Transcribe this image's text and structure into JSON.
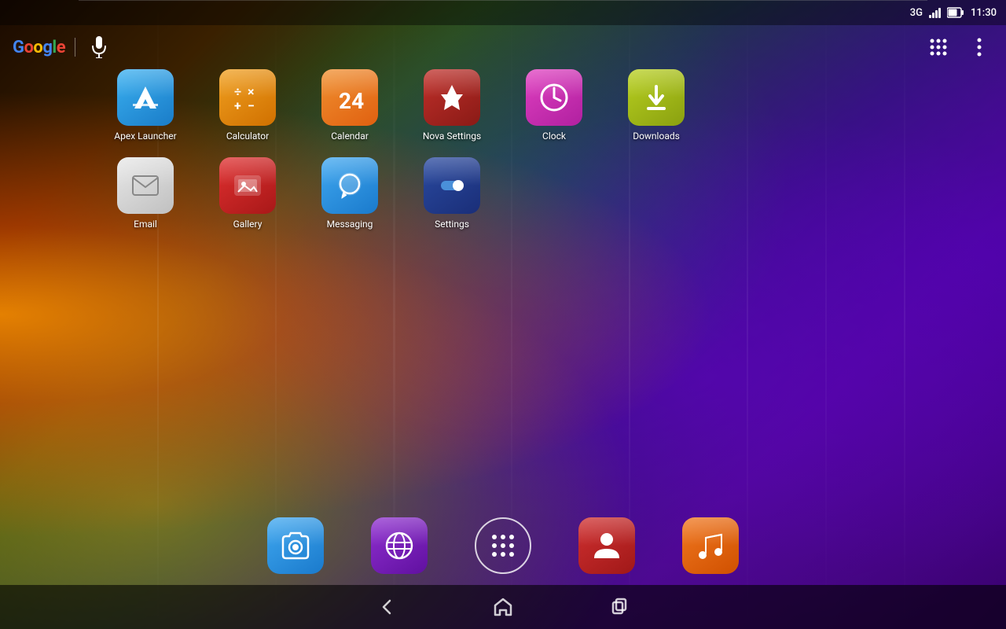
{
  "status_bar": {
    "network": "3G",
    "time": "11:30",
    "battery_level": 70
  },
  "top_bar": {
    "google_label": "Google",
    "mic_label": "Voice Search"
  },
  "apps_row1": [
    {
      "id": "apex-launcher",
      "label": "Apex Launcher",
      "icon_type": "apex"
    },
    {
      "id": "calculator",
      "label": "Calculator",
      "icon_type": "calculator"
    },
    {
      "id": "calendar",
      "label": "Calendar",
      "icon_type": "calendar"
    },
    {
      "id": "nova-settings",
      "label": "Nova Settings",
      "icon_type": "nova"
    },
    {
      "id": "clock",
      "label": "Clock",
      "icon_type": "clock"
    },
    {
      "id": "downloads",
      "label": "Downloads",
      "icon_type": "downloads"
    }
  ],
  "apps_row2": [
    {
      "id": "email",
      "label": "Email",
      "icon_type": "email"
    },
    {
      "id": "gallery",
      "label": "Gallery",
      "icon_type": "gallery"
    },
    {
      "id": "messaging",
      "label": "Messaging",
      "icon_type": "messaging"
    },
    {
      "id": "settings",
      "label": "Settings",
      "icon_type": "settings"
    }
  ],
  "dock": [
    {
      "id": "camera",
      "label": "Camera",
      "icon_type": "camera-dock"
    },
    {
      "id": "browser",
      "label": "Browser",
      "icon_type": "browser-dock"
    },
    {
      "id": "app-drawer",
      "label": "Apps",
      "icon_type": "apps-grid"
    },
    {
      "id": "contacts",
      "label": "Contacts",
      "icon_type": "contacts-dock"
    },
    {
      "id": "music",
      "label": "Music",
      "icon_type": "music-dock"
    }
  ],
  "nav": {
    "back_label": "Back",
    "home_label": "Home",
    "recents_label": "Recent Apps"
  },
  "top_right": {
    "grid_label": "All Apps",
    "menu_label": "Options"
  }
}
